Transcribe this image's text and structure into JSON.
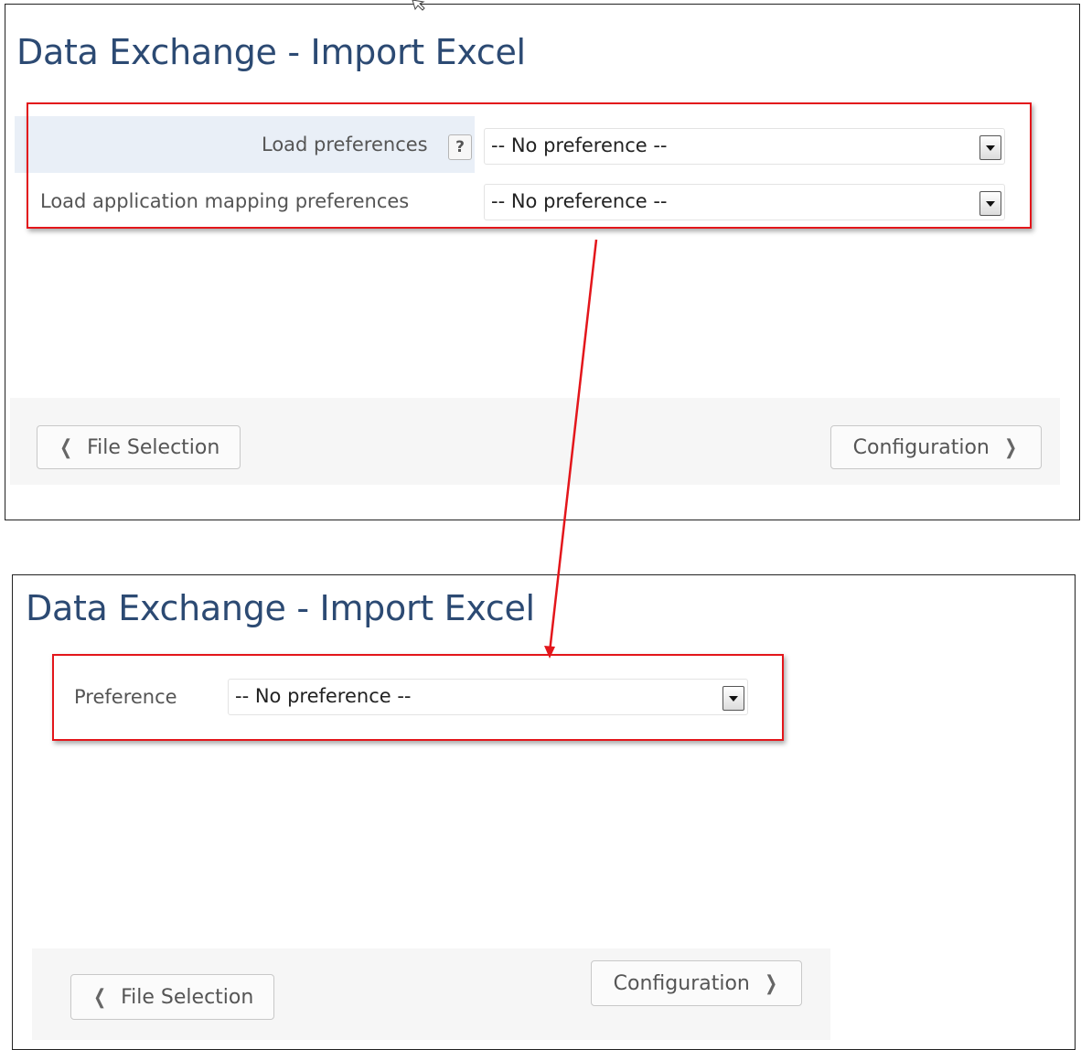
{
  "colors": {
    "title": "#2c4a73",
    "highlight_red": "#e3161b",
    "row_highlight": "#e9eff7",
    "footer_bg": "#f6f6f6"
  },
  "before": {
    "title": "Data Exchange - Import Excel",
    "load_preferences": {
      "label": "Load preferences",
      "help": "?",
      "value": "-- No preference --"
    },
    "load_mapping_preferences": {
      "label": "Load application mapping preferences",
      "value": "-- No preference --"
    },
    "footer": {
      "back_label": "File Selection",
      "next_label": "Configuration"
    }
  },
  "after": {
    "title": "Data Exchange - Import Excel",
    "preference": {
      "label": "Preference",
      "value": "-- No preference --"
    },
    "footer": {
      "back_label": "File Selection",
      "next_label": "Configuration"
    }
  },
  "icons": {
    "back": "chevron-left-icon",
    "next": "chevron-right-icon",
    "dropdown": "caret-down-icon",
    "help": "question-mark-icon",
    "cursor": "mouse-cursor-icon"
  }
}
